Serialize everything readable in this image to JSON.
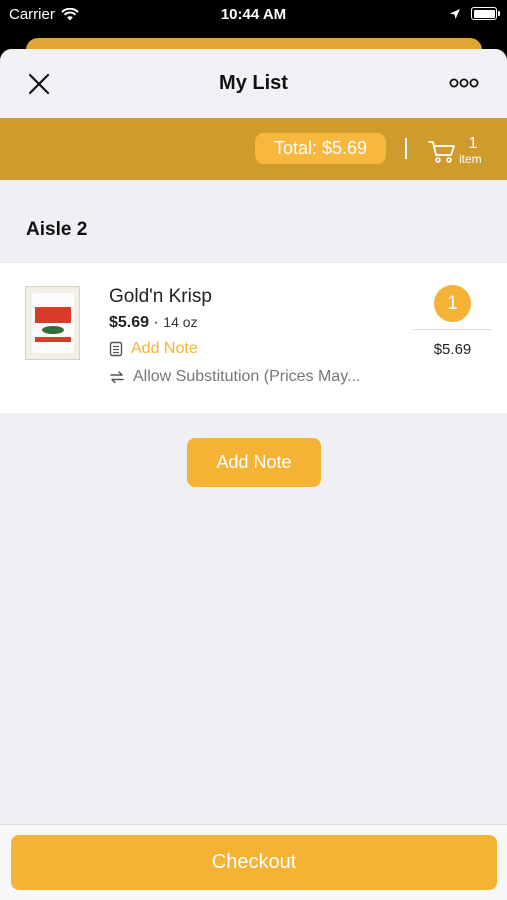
{
  "status_bar": {
    "carrier": "Carrier",
    "time": "10:44 AM",
    "icons": [
      "wifi-icon",
      "location-icon",
      "battery-icon"
    ]
  },
  "nav": {
    "title": "My List",
    "left_icon": "close-icon",
    "right_icon": "more-icon"
  },
  "summary": {
    "total_label": "Total: $5.69",
    "cart_count": "1",
    "cart_unit": "item",
    "cart_icon": "cart-icon"
  },
  "list": {
    "aisle_title": "Aisle 2",
    "items": [
      {
        "name": "Gold'n Krisp",
        "price": "$5.69",
        "separator": "·",
        "size": "14 oz",
        "note_action": "Add Note",
        "note_icon": "note-icon",
        "substitution": "Allow Substitution (Prices May...",
        "substitution_icon": "swap-icon",
        "quantity": "1",
        "line_total": "$5.69"
      }
    ]
  },
  "actions": {
    "add_note": "Add Note",
    "checkout": "Checkout"
  },
  "colors": {
    "accent": "#f5b335",
    "total_bar": "#cf9b2d",
    "background": "#efeff4"
  }
}
